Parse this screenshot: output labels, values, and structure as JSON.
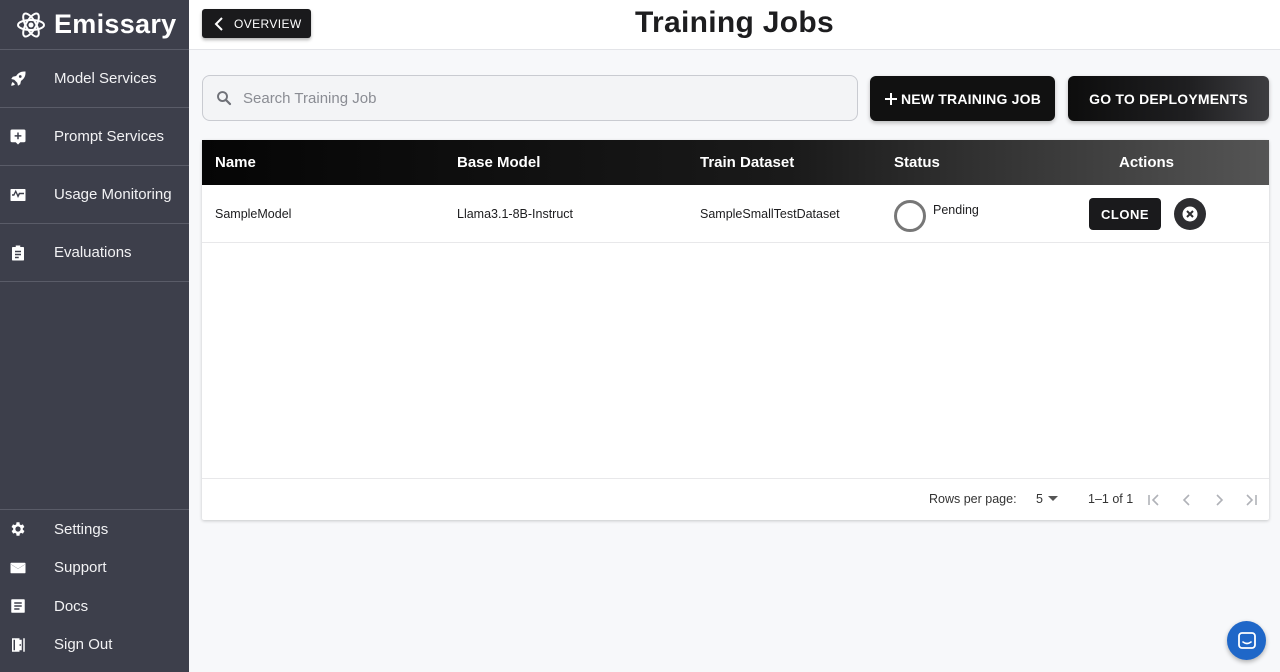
{
  "brand": {
    "name": "Emissary",
    "icon": "atom-icon"
  },
  "sidebar": {
    "items": [
      {
        "label": "Model Services",
        "icon": "rocket-icon"
      },
      {
        "label": "Prompt Services",
        "icon": "add-box-icon"
      },
      {
        "label": "Usage Monitoring",
        "icon": "monitoring-icon"
      },
      {
        "label": "Evaluations",
        "icon": "clipboard-icon"
      }
    ],
    "bottom": [
      {
        "label": "Settings",
        "icon": "gear-icon"
      },
      {
        "label": "Support",
        "icon": "mail-icon"
      },
      {
        "label": "Docs",
        "icon": "document-icon"
      },
      {
        "label": "Sign Out",
        "icon": "exit-door-icon"
      }
    ]
  },
  "header": {
    "back_label": "OVERVIEW",
    "title": "Training Jobs"
  },
  "search": {
    "placeholder": "Search Training Job",
    "value": ""
  },
  "toolbar": {
    "new_label": "NEW TRAINING JOB",
    "go_label": "GO TO DEPLOYMENTS"
  },
  "table": {
    "columns": [
      "Name",
      "Base Model",
      "Train Dataset",
      "Status",
      "Actions"
    ],
    "rows": [
      {
        "name": "SampleModel",
        "base_model": "Llama3.1-8B-Instruct",
        "dataset": "SampleSmallTestDataset",
        "status": "Pending",
        "clone_label": "CLONE"
      }
    ]
  },
  "pagination": {
    "rows_label": "Rows per page:",
    "rows_value": "5",
    "range": "1–1 of 1"
  },
  "colors": {
    "sidebar": "#3d3f4b",
    "chat_fab": "#1f67c8",
    "header_dark": "#050505"
  }
}
